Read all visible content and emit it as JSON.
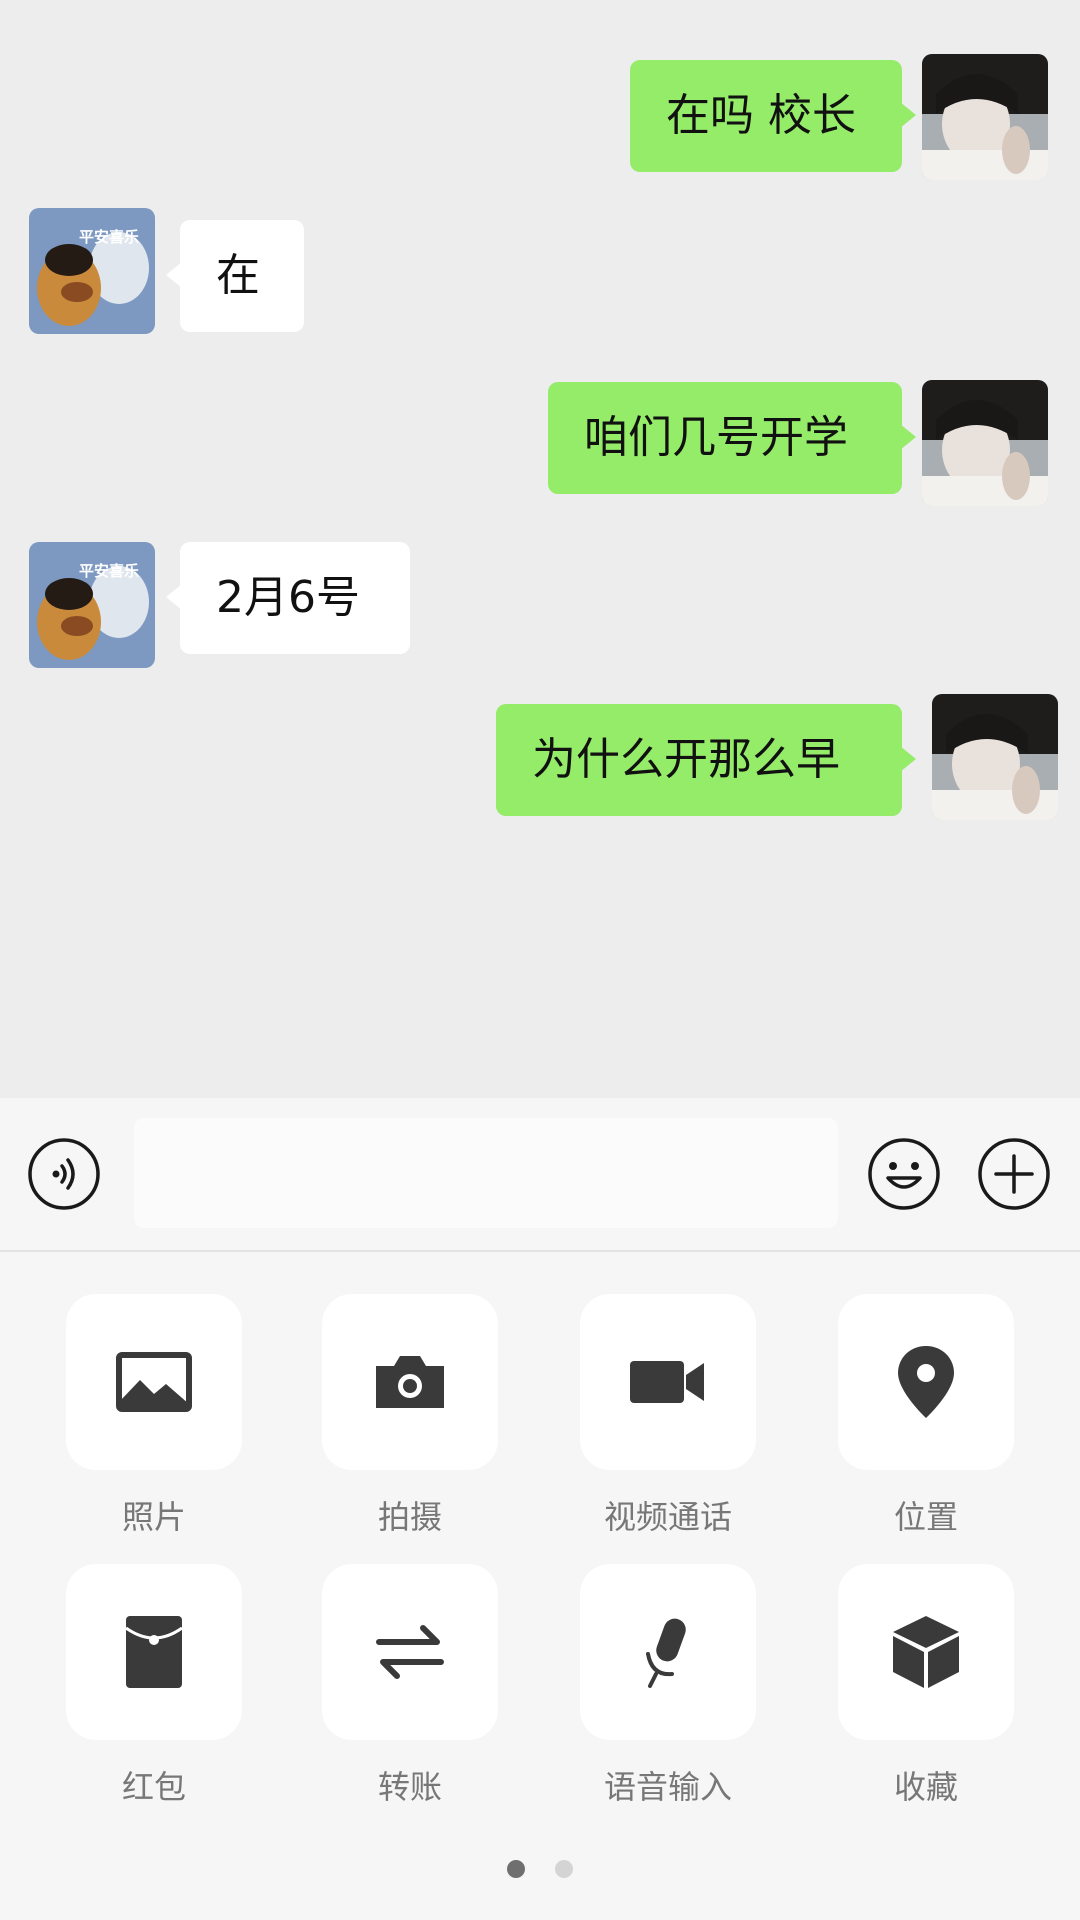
{
  "colors": {
    "background": "#ededed",
    "outgoing_bubble": "#95ec69",
    "incoming_bubble": "#ffffff",
    "icon": "#3a3a3a",
    "panel": "#f6f6f6"
  },
  "messages": [
    {
      "direction": "out",
      "text": "在吗 校长"
    },
    {
      "direction": "in",
      "text": "在"
    },
    {
      "direction": "out",
      "text": "咱们几号开学"
    },
    {
      "direction": "in",
      "text": "2月6号"
    },
    {
      "direction": "out",
      "text": "为什么开那么早"
    }
  ],
  "contact_avatar": {
    "sticker_text": "平安喜乐"
  },
  "input_bar": {
    "voice_icon": "voice-icon",
    "text_value": "",
    "emoji_icon": "emoji-icon",
    "more_icon": "plus-icon"
  },
  "tools": [
    {
      "label": "照片",
      "icon": "image-icon"
    },
    {
      "label": "拍摄",
      "icon": "camera-icon"
    },
    {
      "label": "视频通话",
      "icon": "video-camera-icon"
    },
    {
      "label": "位置",
      "icon": "location-pin-icon"
    },
    {
      "label": "红包",
      "icon": "red-packet-icon"
    },
    {
      "label": "转账",
      "icon": "transfer-icon"
    },
    {
      "label": "语音输入",
      "icon": "microphone-icon"
    },
    {
      "label": "收藏",
      "icon": "cube-icon"
    }
  ],
  "pager": {
    "pages": 2,
    "current": 1
  }
}
